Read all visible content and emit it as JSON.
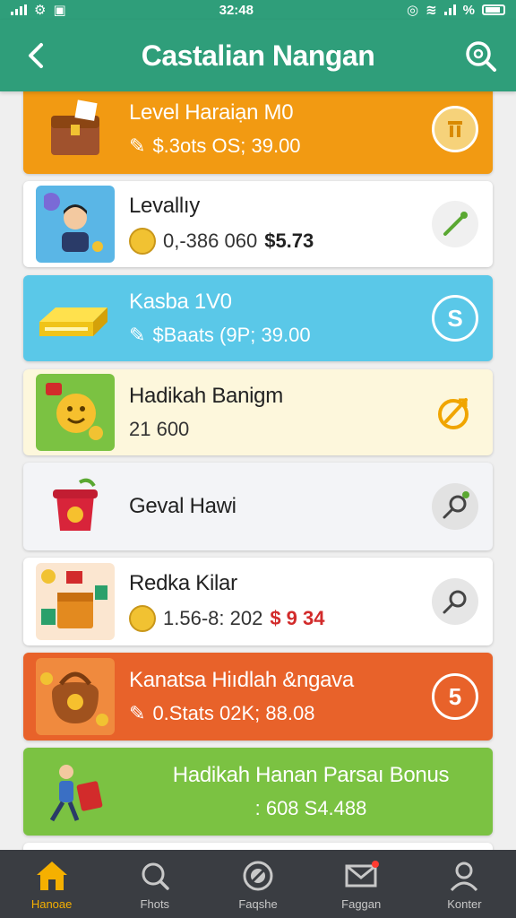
{
  "status": {
    "time": "32:48",
    "battery_text": "%"
  },
  "header": {
    "title": "Castalian Nangan"
  },
  "colors": {
    "header": "#2f9e7a",
    "orange": "#f29a12",
    "blue": "#5ac8e8",
    "cream": "#fdf7dc",
    "red_orange": "#e8622a",
    "green": "#7bc242",
    "nav": "#3a3d42",
    "active": "#f5b000"
  },
  "cards": [
    {
      "name": "Level Haraiạn M0",
      "meta": "$.3ots  OS; 39.00",
      "action_icon": "trash-badge-icon"
    },
    {
      "name": "Levallıy",
      "meta": "0,-386 060",
      "price": "$5.73",
      "action_icon": "green-pin-icon"
    },
    {
      "name": "Kasba 1V0",
      "meta": "$Baats  (9P; 39.00",
      "action_icon": "dollar-circle-icon",
      "action_label": "S"
    },
    {
      "name": "Hadikah Banigm",
      "meta": "21  600",
      "action_icon": "target-icon"
    },
    {
      "name": "Geval Hawi",
      "action_icon": "pin-search-icon"
    },
    {
      "name": "Redka Kilar",
      "meta": "1.56-8: 202",
      "price": "$ 9 34",
      "action_icon": "pin-search-icon"
    },
    {
      "name": "Kanatsa Hiıdlah &ngava",
      "meta": "0.Stats  02K; 88.08",
      "action_icon": "five-circle-icon",
      "action_label": "5"
    },
    {
      "name": "Hadikah Hanan Parsaı Bonus",
      "meta": ": 608  S4.488"
    }
  ],
  "nav": [
    {
      "label": "Hanoae",
      "icon": "home-icon"
    },
    {
      "label": "Fhots",
      "icon": "refresh-search-icon"
    },
    {
      "label": "Faqshe",
      "icon": "badge-icon"
    },
    {
      "label": "Faggan",
      "icon": "mail-icon"
    },
    {
      "label": "Konter",
      "icon": "person-icon"
    }
  ]
}
